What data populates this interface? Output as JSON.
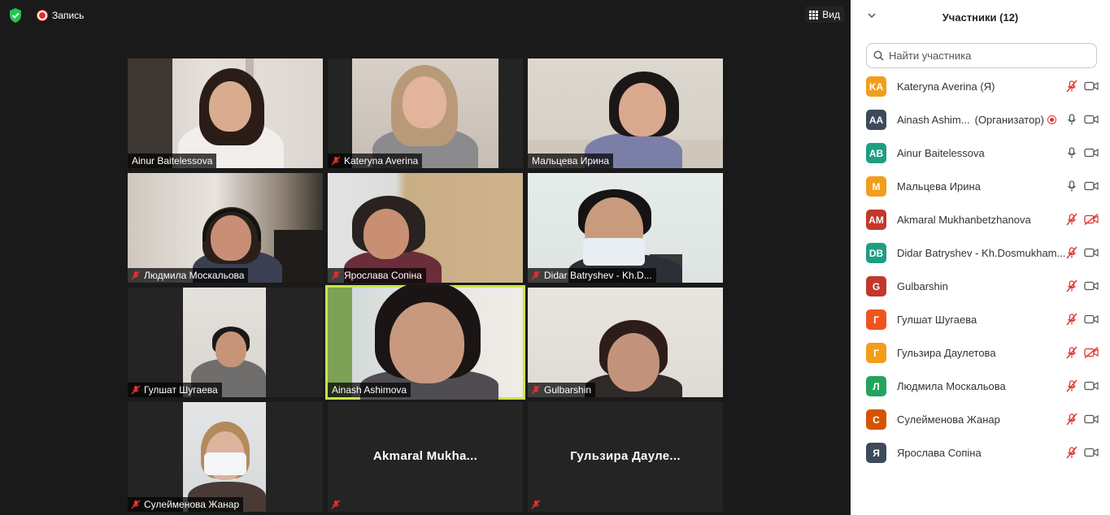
{
  "topbar": {
    "recording_label": "Запись",
    "view_label": "Вид"
  },
  "tiles": [
    {
      "name": "Ainur Baitelessova",
      "muted": false,
      "video": true
    },
    {
      "name": "Kateryna Averina",
      "muted": true,
      "video": true
    },
    {
      "name": "Мальцева Ирина",
      "muted": false,
      "video": true
    },
    {
      "name": "Людмила Москальова",
      "muted": true,
      "video": true
    },
    {
      "name": "Ярослава Сопіна",
      "muted": true,
      "video": true
    },
    {
      "name": "Didar Batryshev - Kh.D...",
      "muted": true,
      "video": true
    },
    {
      "name": "Гулшат Шугаева",
      "muted": true,
      "video": true
    },
    {
      "name": "Ainash Ashimova",
      "muted": false,
      "video": true,
      "active": true
    },
    {
      "name": "Gulbarshin",
      "muted": true,
      "video": true
    },
    {
      "name": "Сулейменова Жанар",
      "muted": true,
      "video": true
    },
    {
      "name": "Akmaral  Mukha...",
      "muted": true,
      "video": false
    },
    {
      "name": "Гульзира  Дауле...",
      "muted": true,
      "video": false
    }
  ],
  "panel": {
    "title": "Участники (12)",
    "search_placeholder": "Найти участника",
    "participants": [
      {
        "initials": "KA",
        "name": "Kateryna Averina (Я)",
        "role": "",
        "color": "#f29e1a",
        "mic": "muted",
        "cam": "on"
      },
      {
        "initials": "AA",
        "name": "Ainash Ashim...",
        "role": "(Организатор)",
        "color": "#3d4a5c",
        "mic": "on",
        "cam": "on",
        "recording": true
      },
      {
        "initials": "AB",
        "name": "Ainur Baitelessova",
        "role": "",
        "color": "#1e9e84",
        "mic": "on",
        "cam": "on"
      },
      {
        "initials": "М",
        "name": "Мальцева Ирина",
        "role": "",
        "color": "#f29e1a",
        "mic": "on",
        "cam": "on"
      },
      {
        "initials": "AM",
        "name": "Akmaral Mukhanbetzhanova",
        "role": "",
        "color": "#c0392b",
        "mic": "muted",
        "cam": "off"
      },
      {
        "initials": "DB",
        "name": "Didar Batryshev - Kh.Dosmukham...",
        "role": "",
        "color": "#1e9e84",
        "mic": "muted",
        "cam": "on"
      },
      {
        "initials": "G",
        "name": "Gulbarshin",
        "role": "",
        "color": "#c0392b",
        "mic": "muted",
        "cam": "on"
      },
      {
        "initials": "Г",
        "name": "Гулшат Шугаева",
        "role": "",
        "color": "#f0541e",
        "mic": "muted",
        "cam": "on"
      },
      {
        "initials": "Г",
        "name": "Гульзира Даулетова",
        "role": "",
        "color": "#f29e1a",
        "mic": "muted",
        "cam": "off"
      },
      {
        "initials": "Л",
        "name": "Людмила Москальова",
        "role": "",
        "color": "#22a55a",
        "mic": "muted",
        "cam": "on"
      },
      {
        "initials": "С",
        "name": "Сулейменова Жанар",
        "role": "",
        "color": "#d35400",
        "mic": "muted",
        "cam": "on"
      },
      {
        "initials": "Я",
        "name": "Ярослава Сопіна",
        "role": "",
        "color": "#3d4a5c",
        "mic": "muted",
        "cam": "on"
      }
    ]
  }
}
